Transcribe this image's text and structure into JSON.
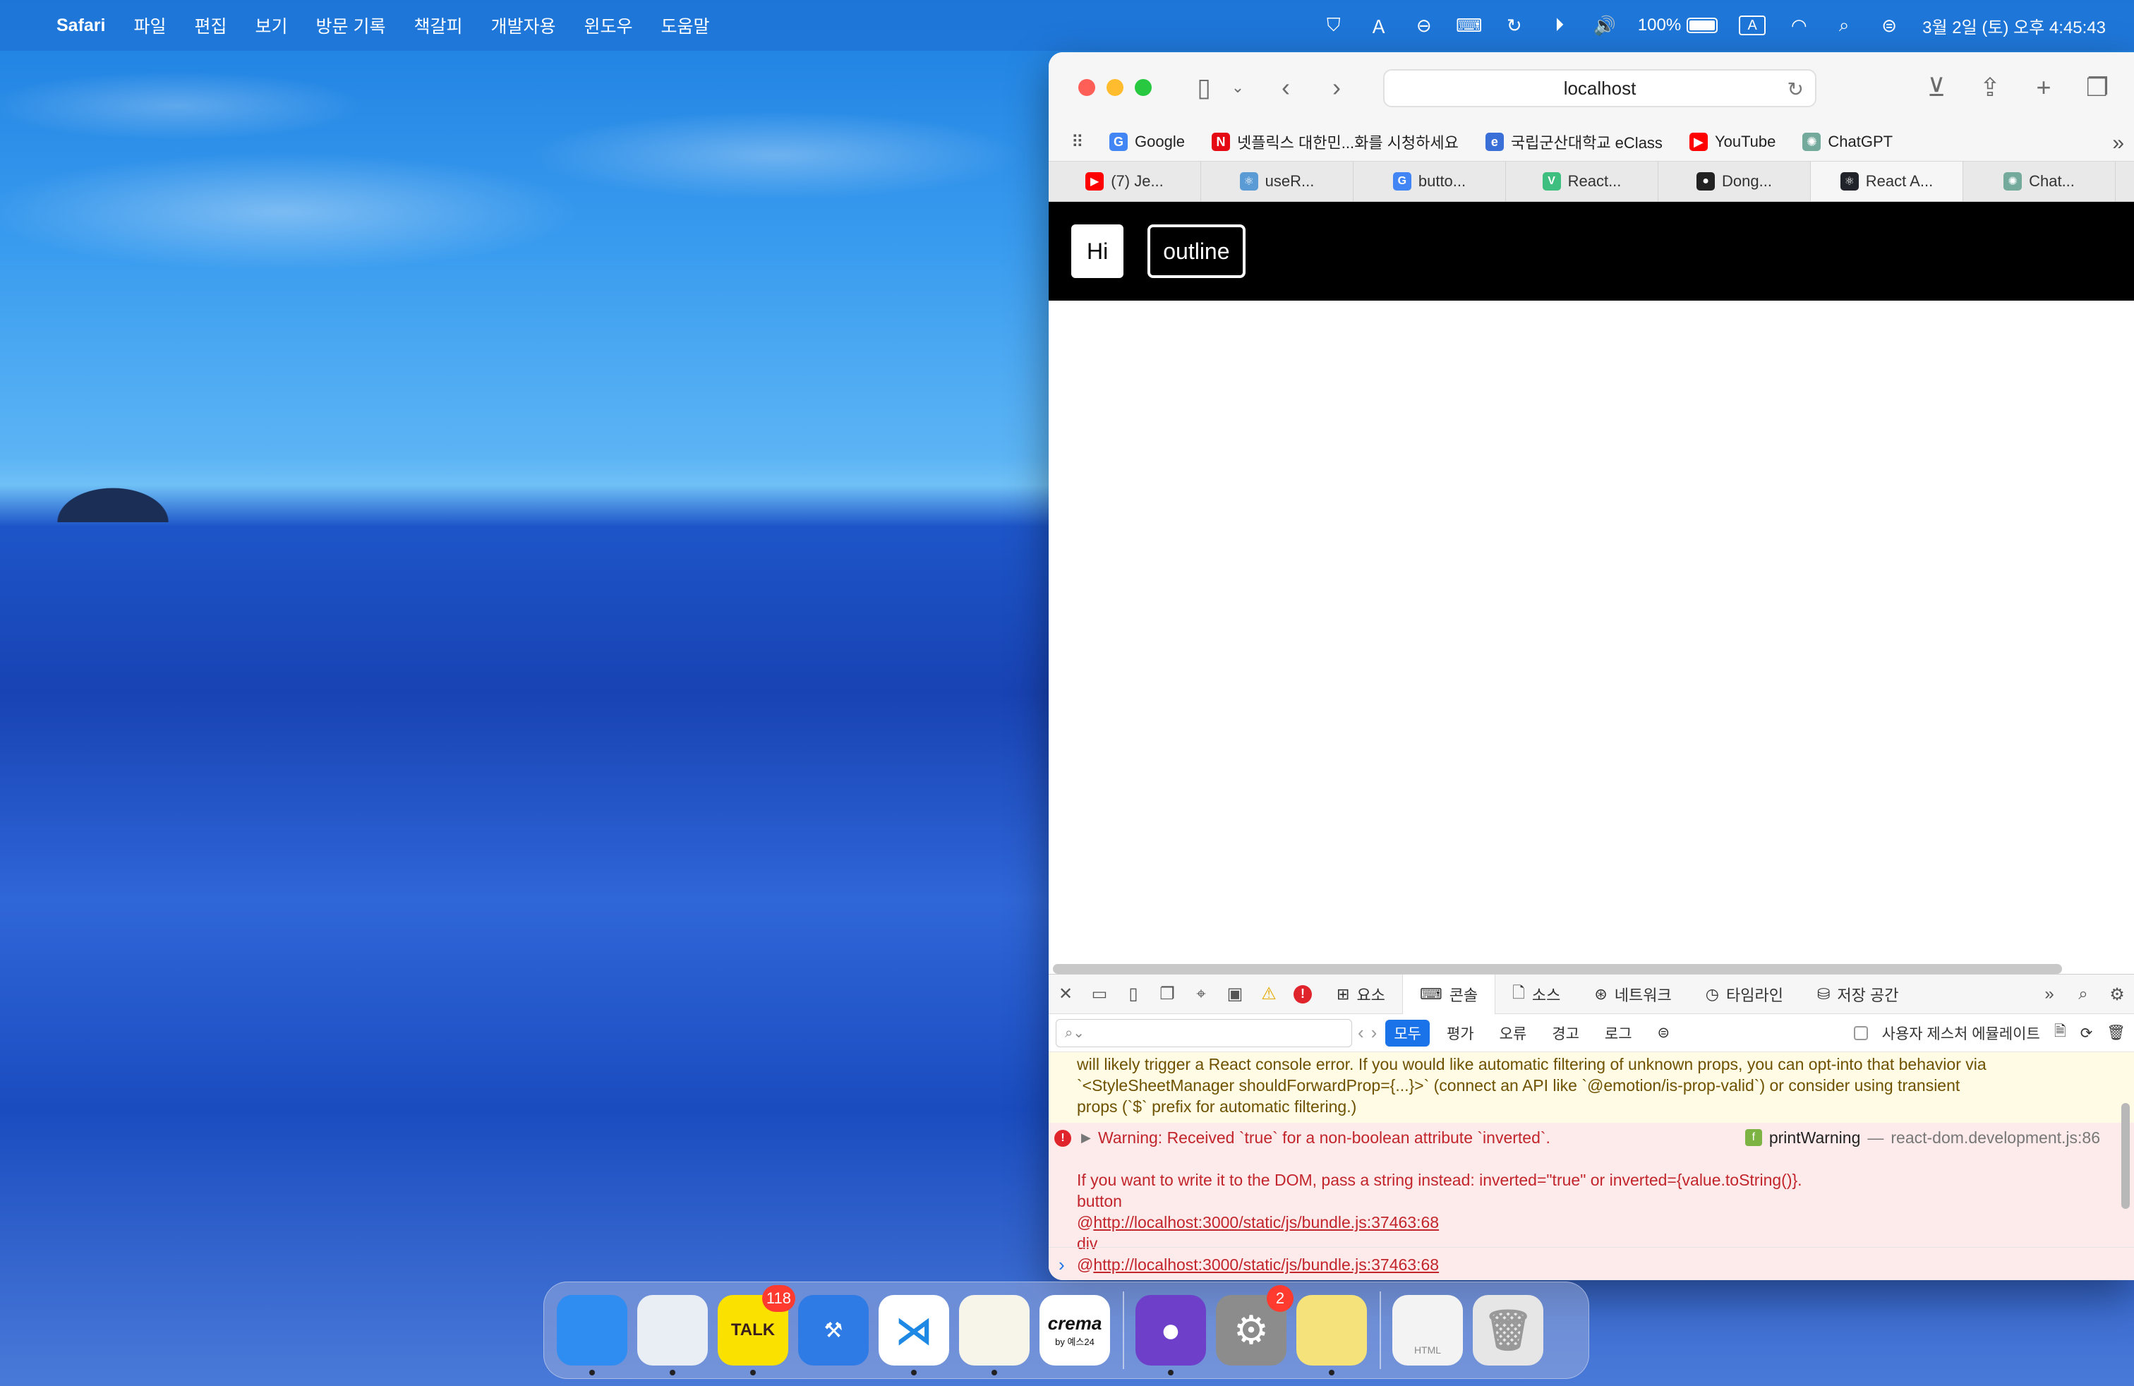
{
  "menubar": {
    "items": [
      "Safari",
      "파일",
      "편집",
      "보기",
      "방문 기록",
      "책갈피",
      "개발자용",
      "윈도우",
      "도움말"
    ],
    "battery": "100%",
    "input_mode": "A",
    "datetime": "3월 2일 (토) 오후 4:45:43"
  },
  "safari": {
    "address": "localhost",
    "favorites": [
      {
        "label": "Google",
        "icon": "G",
        "color": "#4285f4"
      },
      {
        "label": "넷플릭스 대한민...화를 시청하세요",
        "icon": "N",
        "color": "#e50914"
      },
      {
        "label": "국립군산대학교 eClass",
        "icon": "e",
        "color": "#3b6fd8"
      },
      {
        "label": "YouTube",
        "icon": "▶",
        "color": "#ff0000"
      },
      {
        "label": "ChatGPT",
        "icon": "✺",
        "color": "#74aa9c"
      }
    ],
    "tabs": [
      {
        "label": "(7) Je...",
        "icon": "▶",
        "color": "#ff0000"
      },
      {
        "label": "useR...",
        "icon": "⚛",
        "color": "#5a9bd5"
      },
      {
        "label": "butto...",
        "icon": "G",
        "color": "#4285f4"
      },
      {
        "label": "React...",
        "icon": "V",
        "color": "#3fbf7f"
      },
      {
        "label": "Dong...",
        "icon": "●",
        "color": "#222222"
      },
      {
        "label": "React A...",
        "icon": "⚛",
        "color": "#20232a"
      },
      {
        "label": "Chat...",
        "icon": "✺",
        "color": "#74aa9c"
      }
    ],
    "active_tab_index": 5
  },
  "page": {
    "btn_hi": "Hi",
    "btn_outline": "outline"
  },
  "devtools": {
    "tabs": [
      "요소",
      "콘솔",
      "소스",
      "네트워크",
      "타임라인",
      "저장 공간"
    ],
    "active_tab": "콘솔",
    "filters": [
      "모두",
      "평가",
      "오류",
      "경고",
      "로그"
    ],
    "active_filter": "모두",
    "emulate_label": "사용자 제스처 에뮬레이트",
    "warning_text_lines": [
      "will likely trigger a React console error. If you would like automatic filtering of unknown props, you can opt-into that behavior via",
      "`<StyleSheetManager shouldForwardProp={...}>` (connect an API like `@emotion/is-prop-valid`) or consider using transient",
      "props (`$` prefix for automatic filtering.)"
    ],
    "error": {
      "headline": "Warning: Received `true` for a non-boolean attribute `inverted`.",
      "source_fn": "printWarning",
      "source_sep": "—",
      "source_file": "react-dom.development.js:86",
      "detail": "If you want to write it to the DOM, pass a string instead: inverted=\"true\" or inverted={value.toString()}.",
      "stack": [
        {
          "text": "button"
        },
        {
          "prefix": "@",
          "link": "http://localhost:3000/static/js/bundle.js:37463:68"
        },
        {
          "text": "div"
        },
        {
          "prefix": "@",
          "link": "http://localhost:3000/static/js/bundle.js:37463:68"
        }
      ]
    },
    "prompt": "›"
  },
  "dock": {
    "items": [
      {
        "name": "finder",
        "label": "",
        "color": "#2f8cf0",
        "dot": true
      },
      {
        "name": "safari",
        "label": "",
        "color": "#e9eef5",
        "dot": true
      },
      {
        "name": "kakaotalk",
        "label": "TALK",
        "color": "#fae100",
        "badge": "118",
        "dot": true
      },
      {
        "name": "xcode",
        "label": "",
        "color": "#2e7be5",
        "dot": false
      },
      {
        "name": "vscode",
        "label": "",
        "color": "#ffffff",
        "dot": true
      },
      {
        "name": "notes",
        "label": "",
        "color": "#f7f4ea",
        "dot": true
      },
      {
        "name": "crema",
        "label": "crema",
        "sublabel": "by 예스24",
        "color": "#ffffff",
        "dot": false
      },
      {
        "name": "github-desktop",
        "label": "",
        "color": "#6e40c9",
        "dot": true
      },
      {
        "name": "system-settings",
        "label": "",
        "color": "#8c8c8c",
        "badge": "2",
        "dot": false
      },
      {
        "name": "stickies",
        "label": "",
        "color": "#f5e27a",
        "dot": true
      },
      {
        "name": "html-file",
        "label": "HTML",
        "color": "#f3f3f3",
        "dot": false
      },
      {
        "name": "trash",
        "label": "",
        "color": "#e6e6e6",
        "dot": false
      }
    ]
  }
}
